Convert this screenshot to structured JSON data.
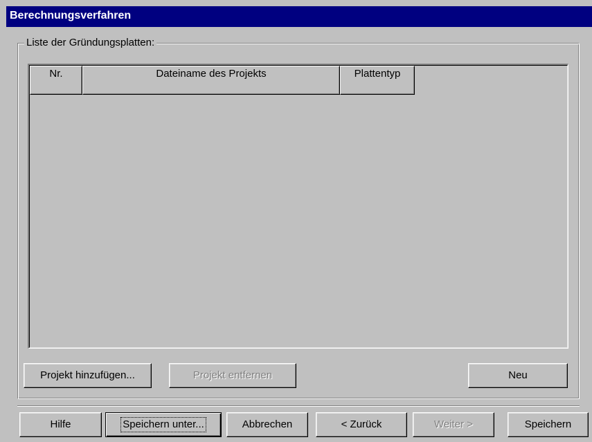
{
  "window": {
    "title": "Berechnungsverfahren"
  },
  "group": {
    "legend": "Liste der Gründungsplatten:"
  },
  "table": {
    "columns": [
      "Nr.",
      "Dateiname des Projekts",
      "Plattentyp"
    ],
    "rows": []
  },
  "buttons": {
    "add_project": "Projekt hinzufügen...",
    "remove_project": "Projekt entfernen",
    "new": "Neu",
    "help": "Hilfe",
    "save_as": "Speichern unter...",
    "cancel": "Abbrechen",
    "back": "< Zurück",
    "next": "Weiter >",
    "save": "Speichern"
  },
  "colors": {
    "titlebar": "#000080",
    "face": "#c0c0c0",
    "disabled_text": "#808080"
  }
}
